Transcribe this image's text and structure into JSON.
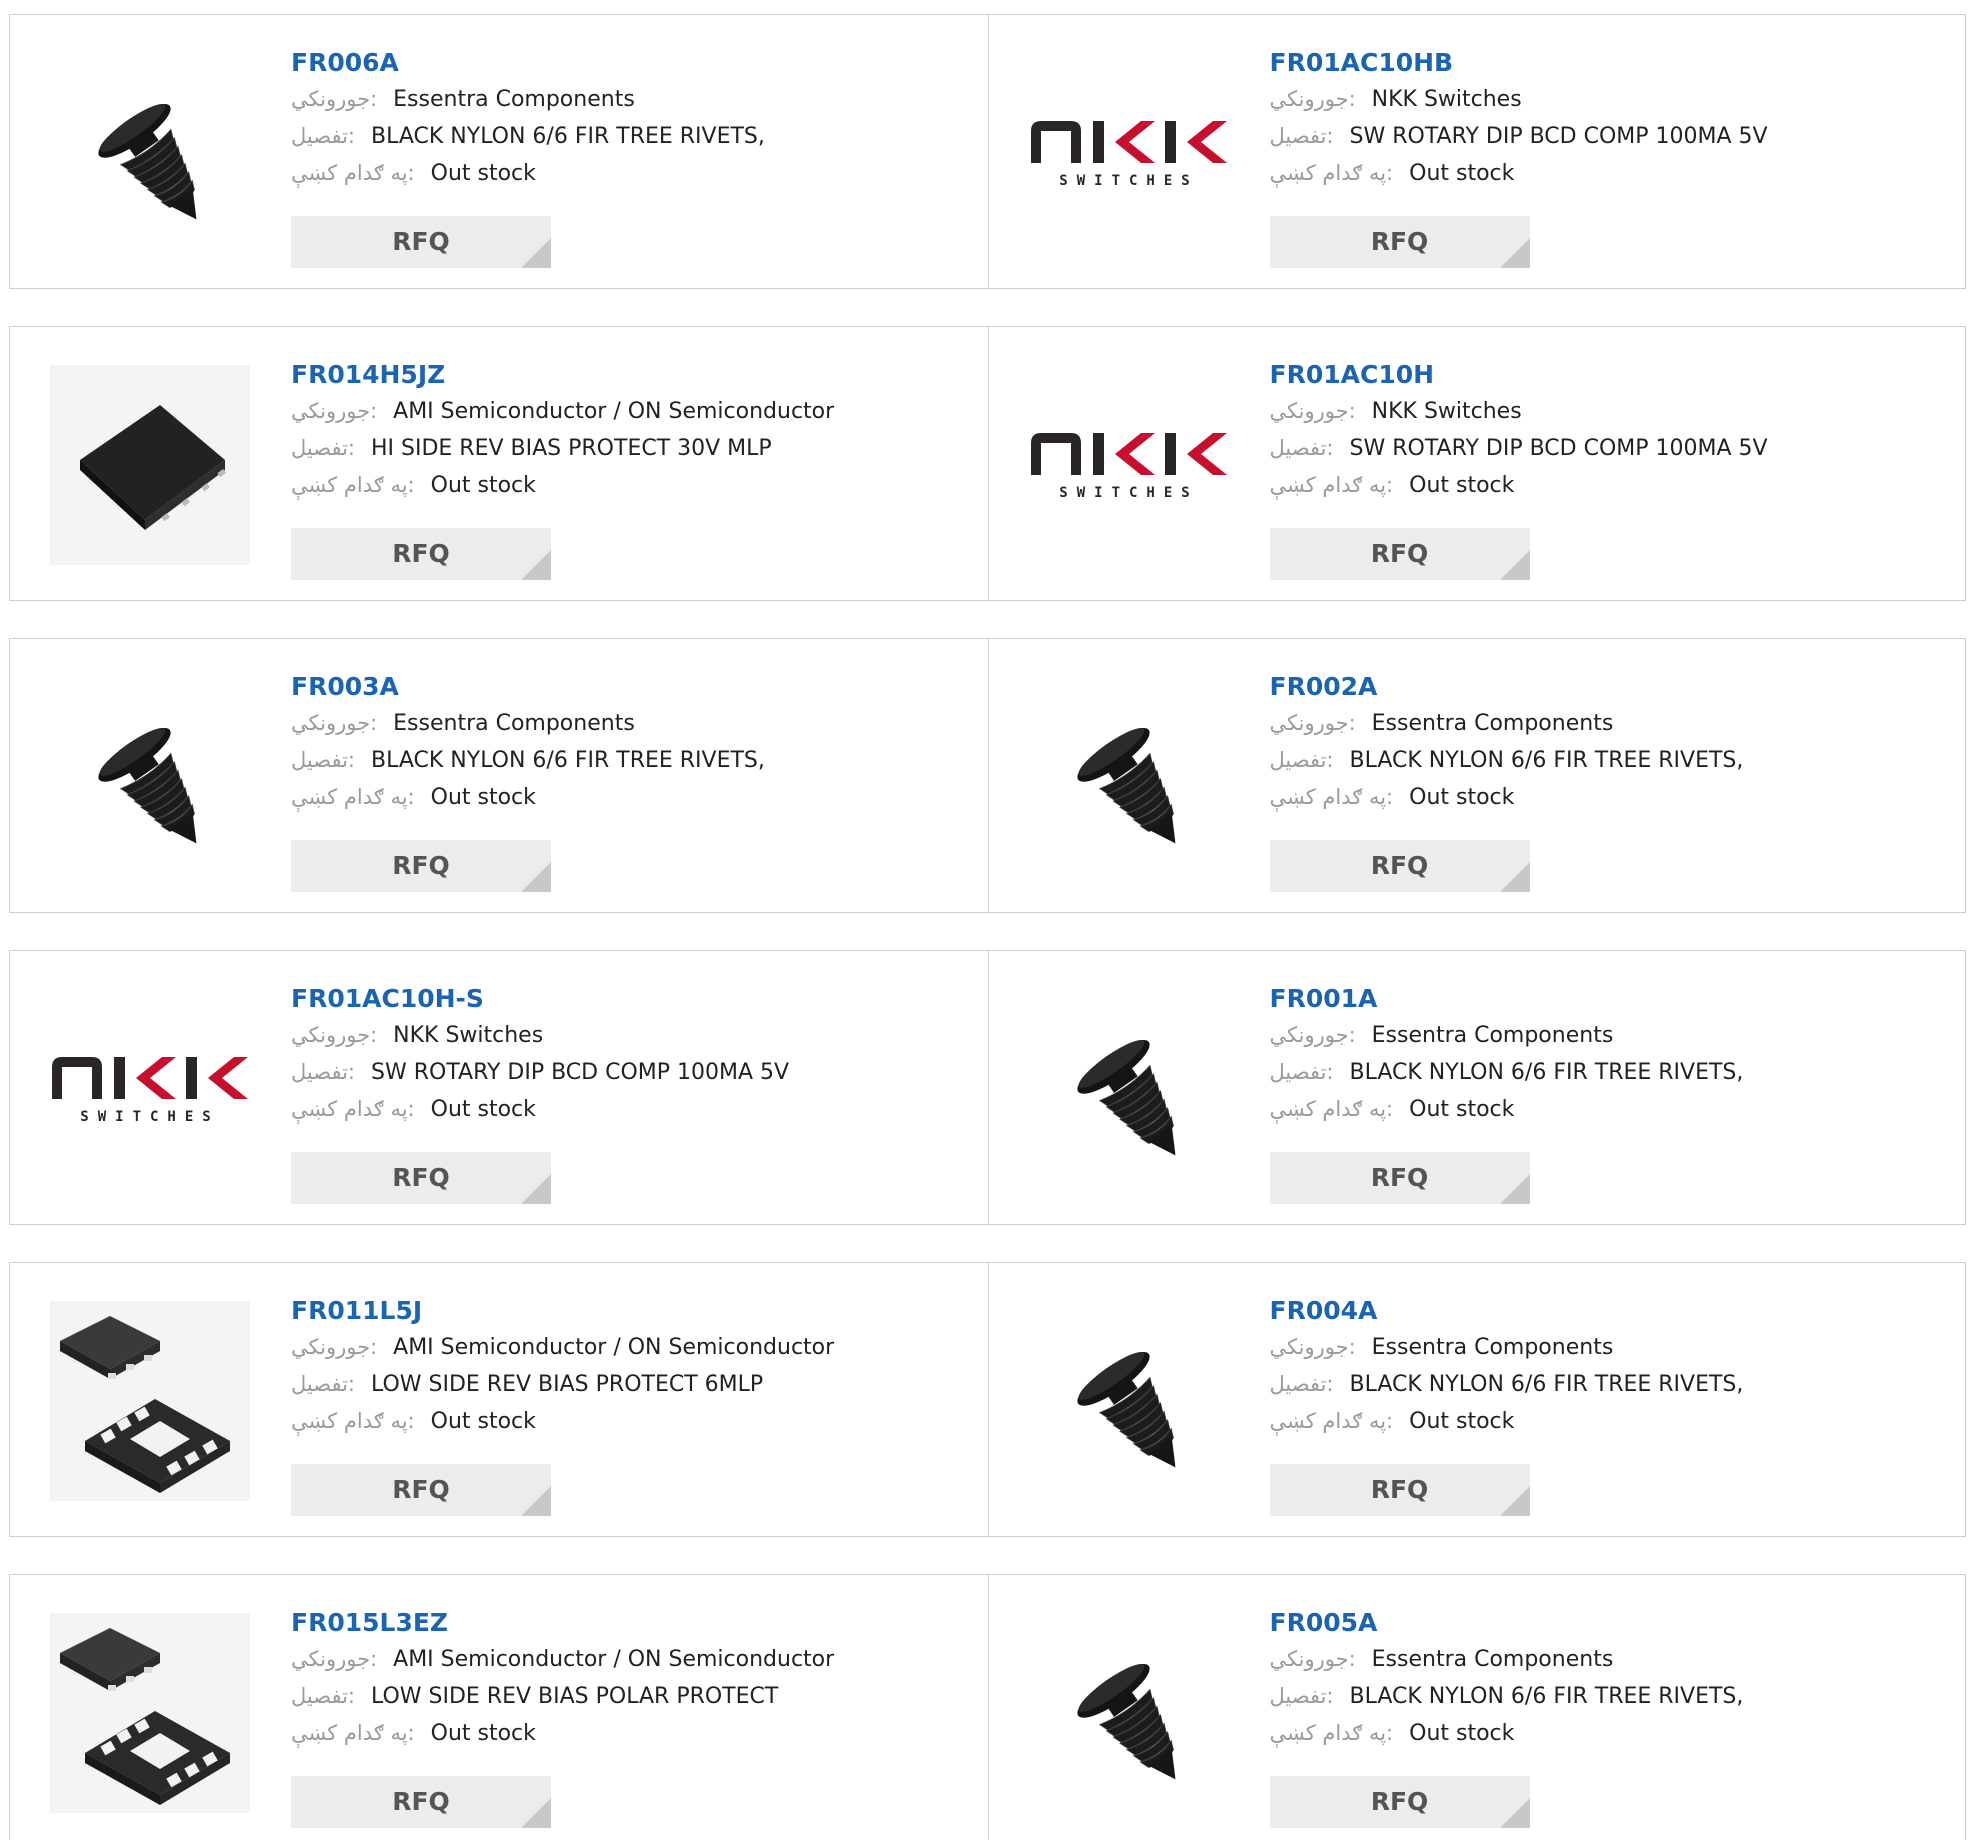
{
  "labels": {
    "manufacturer": "جورونکي:",
    "description": "تفصيل:",
    "stock": "په ګدام کښې:"
  },
  "products": [
    {
      "part": "FR006A",
      "manufacturer": "Essentra Components",
      "description": "BLACK NYLON 6/6 FIR TREE RIVETS,",
      "stock": "Out stock",
      "image": "fir-tree-rivet",
      "rfq": "RFQ"
    },
    {
      "part": "FR01AC10HB",
      "manufacturer": "NKK Switches",
      "description": "SW ROTARY DIP BCD COMP 100MA 5V",
      "stock": "Out stock",
      "image": "nkk-logo",
      "rfq": "RFQ"
    },
    {
      "part": "FR014H5JZ",
      "manufacturer": "AMI Semiconductor / ON Semiconductor",
      "description": "HI SIDE REV BIAS PROTECT 30V MLP",
      "stock": "Out stock",
      "image": "mlp-chip",
      "rfq": "RFQ"
    },
    {
      "part": "FR01AC10H",
      "manufacturer": "NKK Switches",
      "description": "SW ROTARY DIP BCD COMP 100MA 5V",
      "stock": "Out stock",
      "image": "nkk-logo",
      "rfq": "RFQ"
    },
    {
      "part": "FR003A",
      "manufacturer": "Essentra Components",
      "description": "BLACK NYLON 6/6 FIR TREE RIVETS,",
      "stock": "Out stock",
      "image": "fir-tree-rivet",
      "rfq": "RFQ"
    },
    {
      "part": "FR002A",
      "manufacturer": "Essentra Components",
      "description": "BLACK NYLON 6/6 FIR TREE RIVETS,",
      "stock": "Out stock",
      "image": "fir-tree-rivet",
      "rfq": "RFQ"
    },
    {
      "part": "FR01AC10H-S",
      "manufacturer": "NKK Switches",
      "description": "SW ROTARY DIP BCD COMP 100MA 5V",
      "stock": "Out stock",
      "image": "nkk-logo",
      "rfq": "RFQ"
    },
    {
      "part": "FR001A",
      "manufacturer": "Essentra Components",
      "description": "BLACK NYLON 6/6 FIR TREE RIVETS,",
      "stock": "Out stock",
      "image": "fir-tree-rivet",
      "rfq": "RFQ"
    },
    {
      "part": "FR011L5J",
      "manufacturer": "AMI Semiconductor / ON Semiconductor",
      "description": "LOW SIDE REV BIAS PROTECT 6MLP",
      "stock": "Out stock",
      "image": "dfn-package",
      "rfq": "RFQ"
    },
    {
      "part": "FR004A",
      "manufacturer": "Essentra Components",
      "description": "BLACK NYLON 6/6 FIR TREE RIVETS,",
      "stock": "Out stock",
      "image": "fir-tree-rivet",
      "rfq": "RFQ"
    },
    {
      "part": "FR015L3EZ",
      "manufacturer": "AMI Semiconductor / ON Semiconductor",
      "description": "LOW SIDE REV BIAS POLAR PROTECT",
      "stock": "Out stock",
      "image": "dfn-package",
      "rfq": "RFQ"
    },
    {
      "part": "FR005A",
      "manufacturer": "Essentra Components",
      "description": "BLACK NYLON 6/6 FIR TREE RIVETS,",
      "stock": "Out stock",
      "image": "fir-tree-rivet",
      "rfq": "RFQ"
    }
  ],
  "colors": {
    "part_link": "#1b64b2",
    "label": "#9a9a9a",
    "rfq_bg": "#ececec",
    "border": "#cfcfcf"
  }
}
